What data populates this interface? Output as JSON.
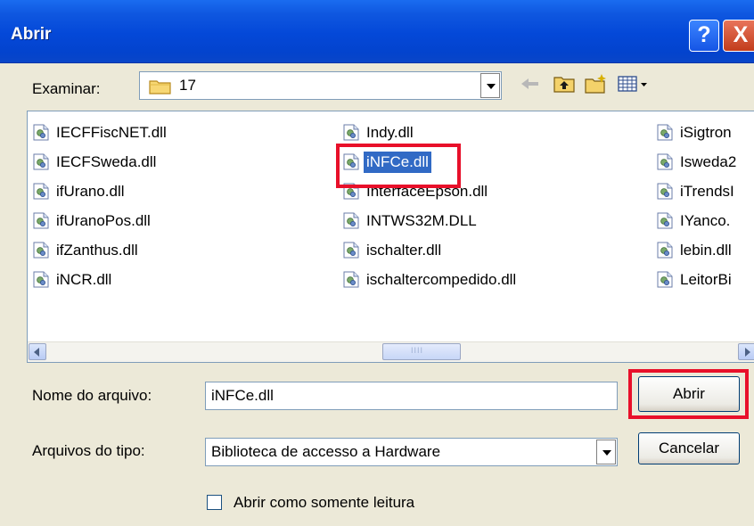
{
  "dialog": {
    "title": "Abrir",
    "help_button": "?",
    "close_button": "X"
  },
  "look_in": {
    "label": "Examinar:",
    "value": "17",
    "icon": "folder-icon"
  },
  "toolbar": {
    "icons": [
      "back-icon",
      "up-folder-icon",
      "new-folder-icon",
      "view-menu-icon"
    ]
  },
  "files": {
    "column1": [
      "IECFFiscNET.dll",
      "IECFSweda.dll",
      "ifUrano.dll",
      "ifUranoPos.dll",
      "ifZanthus.dll",
      "iNCR.dll"
    ],
    "column2": [
      "Indy.dll",
      "iNFCe.dll",
      "InterfaceEpson.dll",
      "INTWS32M.DLL",
      "ischalter.dll",
      "ischaltercompedido.dll"
    ],
    "column3": [
      "iSigtron",
      "Isweda2",
      "iTrendsI",
      "IYanco.",
      "lebin.dll",
      "LeitorBi"
    ],
    "selected": "iNFCe.dll",
    "icon": "dll-file-icon"
  },
  "filename": {
    "label": "Nome do arquivo:",
    "value": "iNFCe.dll"
  },
  "filetype": {
    "label": "Arquivos do tipo:",
    "value": "Biblioteca de accesso a Hardware"
  },
  "buttons": {
    "open": "Abrir",
    "cancel": "Cancelar"
  },
  "readonly_checkbox": {
    "label": "Abrir como somente leitura",
    "checked": false
  },
  "colors": {
    "titlebar": "#0448d8",
    "selection": "#316ac5",
    "highlight_box": "#e8102a",
    "dialog_bg": "#ece9d8"
  }
}
